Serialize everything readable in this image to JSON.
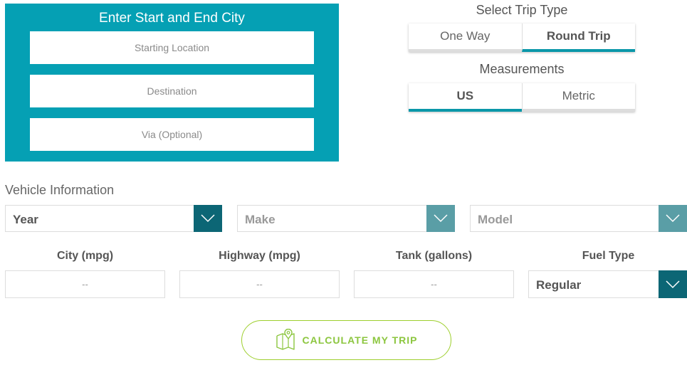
{
  "locations": {
    "title": "Enter Start and End City",
    "start_placeholder": "Starting Location",
    "destination_placeholder": "Destination",
    "via_placeholder": "Via (Optional)"
  },
  "trip_type": {
    "label": "Select Trip Type",
    "options": [
      "One Way",
      "Round Trip"
    ],
    "selected": "Round Trip"
  },
  "measurements": {
    "label": "Measurements",
    "options": [
      "US",
      "Metric"
    ],
    "selected": "US"
  },
  "vehicle": {
    "label": "Vehicle Information",
    "year": "Year",
    "make": "Make",
    "model": "Model"
  },
  "efficiency": {
    "city_label": "City (mpg)",
    "city_placeholder": "--",
    "highway_label": "Highway (mpg)",
    "highway_placeholder": "--",
    "tank_label": "Tank (gallons)",
    "tank_placeholder": "--",
    "fuel_label": "Fuel Type",
    "fuel_value": "Regular"
  },
  "calculate": {
    "label": "CALCULATE MY TRIP",
    "icon": "map-pin-icon"
  },
  "colors": {
    "panel": "#05a0b4",
    "accent": "#0a97a9",
    "dropdown_dark": "#0c6675",
    "dropdown_muted": "#5a9ea6",
    "cta_green": "#8cc63f"
  }
}
